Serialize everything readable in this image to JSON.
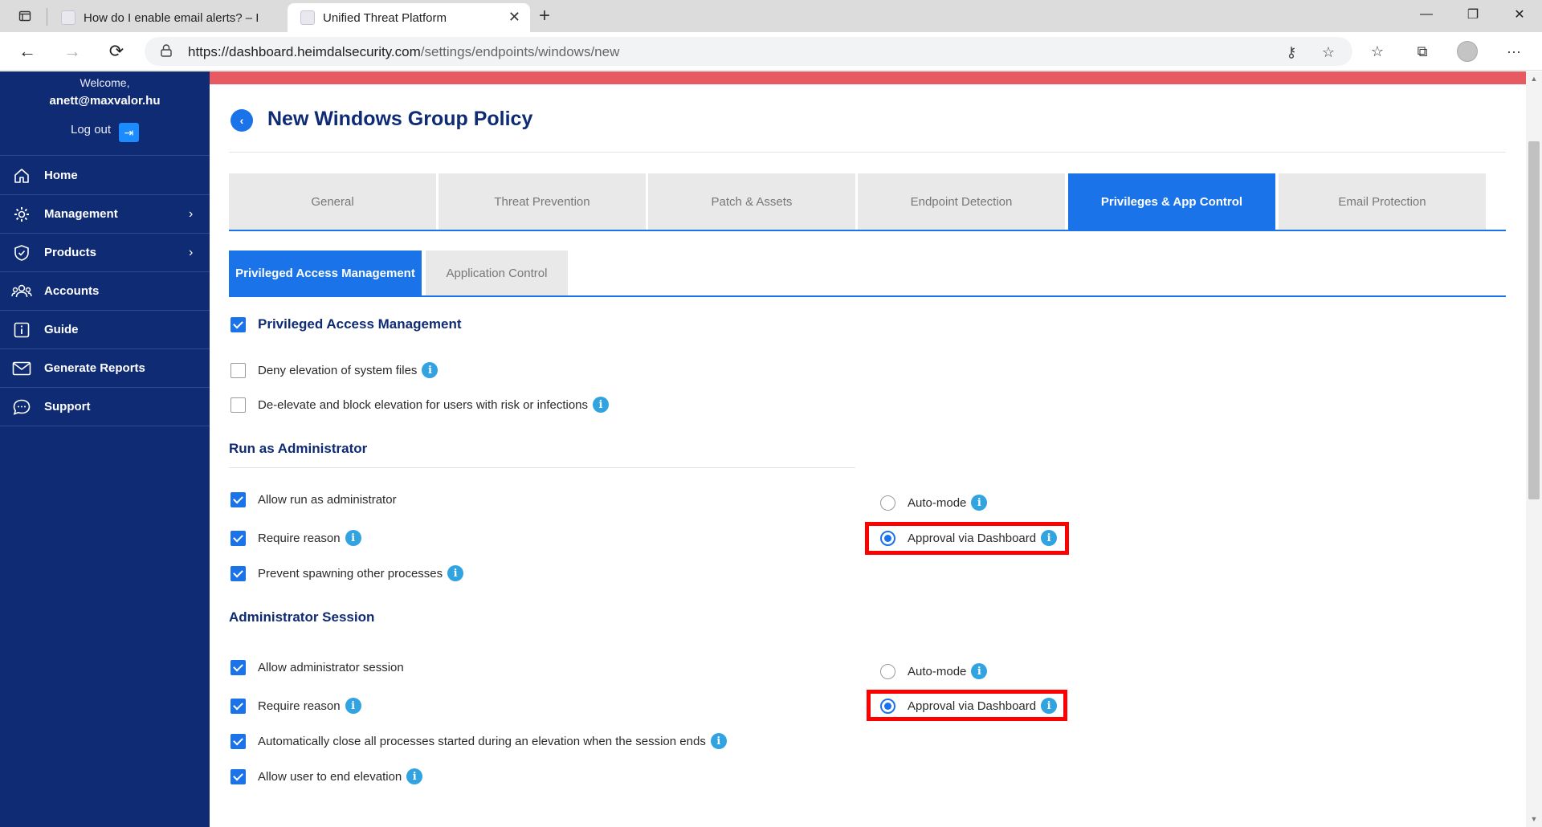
{
  "browser": {
    "tabs": [
      {
        "title": "How do I enable email alerts? – I"
      },
      {
        "title": "Unified Threat Platform"
      }
    ],
    "url_host": "https://dashboard.heimdalsecurity.com",
    "url_path": "/settings/endpoints/windows/new"
  },
  "sidebar": {
    "welcome": "Welcome,",
    "email": "anett@maxvalor.hu",
    "logout": "Log out",
    "items": [
      {
        "label": "Home",
        "icon": "home-icon"
      },
      {
        "label": "Management",
        "icon": "gear-icon"
      },
      {
        "label": "Products",
        "icon": "shield-icon"
      },
      {
        "label": "Accounts",
        "icon": "users-icon"
      },
      {
        "label": "Guide",
        "icon": "info-box-icon"
      },
      {
        "label": "Generate Reports",
        "icon": "mail-icon"
      },
      {
        "label": "Support",
        "icon": "chat-icon"
      }
    ]
  },
  "page": {
    "title": "New Windows Group Policy",
    "tabs": [
      "General",
      "Threat Prevention",
      "Patch & Assets",
      "Endpoint Detection",
      "Privileges & App Control",
      "Email Protection"
    ],
    "active_tab": "Privileges & App Control",
    "subtabs": [
      "Privileged Access Management",
      "Application Control"
    ],
    "pam": {
      "label": "Privileged Access Management",
      "deny_elevation": "Deny elevation of system files",
      "de_elevate": "De-elevate and block elevation for users with risk or infections"
    },
    "run_as_admin": {
      "title": "Run as Administrator",
      "allow": "Allow run as administrator",
      "require_reason": "Require reason",
      "prevent_spawning": "Prevent spawning other processes",
      "auto_mode": "Auto-mode",
      "approval": "Approval via Dashboard"
    },
    "admin_session": {
      "title": "Administrator Session",
      "allow": "Allow administrator session",
      "require_reason": "Require reason",
      "auto_close": "Automatically close all processes started during an elevation when the session ends",
      "allow_end": "Allow user to end elevation",
      "auto_mode": "Auto-mode",
      "approval": "Approval via Dashboard"
    }
  },
  "colors": {
    "sidebar_bg": "#0f2b74",
    "accent": "#1a73e8",
    "alert_bar": "#e85a62",
    "highlight": "#ff0000"
  }
}
